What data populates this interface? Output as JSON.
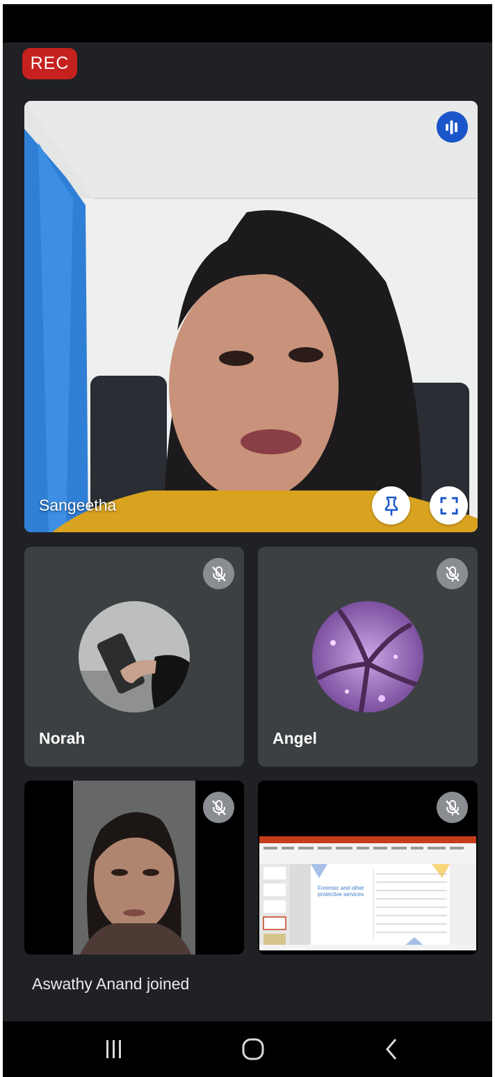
{
  "status": {
    "recording_label": "REC"
  },
  "main_participant": {
    "name": "Sangeetha",
    "speaking": true
  },
  "participants": [
    {
      "name": "Norah",
      "muted": true
    },
    {
      "name": "Angel",
      "muted": true
    },
    {
      "name": "",
      "muted": true
    },
    {
      "name": "",
      "muted": true
    }
  ],
  "presentation": {
    "slide_title": "Forensic and other protective services"
  },
  "toast": {
    "message": "Aswathy Anand joined"
  },
  "colors": {
    "background": "#202124",
    "tile": "#3c4043",
    "rec": "#c5221f",
    "speaking": "#1a56c9",
    "muted_badge": "#8a8d91"
  },
  "icons": {
    "speaking": "audio-level-icon",
    "muted": "mic-off-icon",
    "pin": "pin-icon",
    "fullscreen": "fullscreen-icon",
    "nav_recents": "recents-icon",
    "nav_home": "home-icon",
    "nav_back": "back-icon"
  }
}
